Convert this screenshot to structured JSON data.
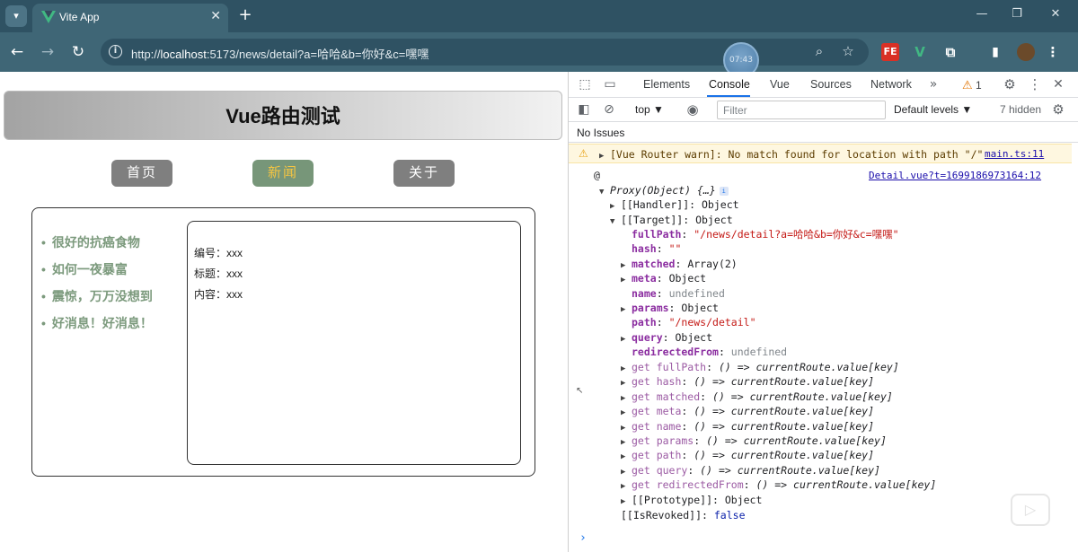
{
  "browser": {
    "tab_title": "Vite App",
    "tab_close": "✕",
    "new_tab": "+",
    "url_prefix": "http://",
    "url_host": "localhost",
    "url_rest": ":5173/news/detail?a=哈哈&b=你好&c=嘿嘿",
    "timer_badge": "07:43",
    "extensions": [
      "FE",
      "V"
    ]
  },
  "app": {
    "title": "Vue路由测试",
    "nav": [
      {
        "label": "首页",
        "active": false
      },
      {
        "label": "新闻",
        "active": true
      },
      {
        "label": "关于",
        "active": false
      }
    ],
    "news_items": [
      "很好的抗癌食物",
      "如何一夜暴富",
      "震惊，万万没想到",
      "好消息！好消息！"
    ],
    "detail": [
      {
        "label": "编号：",
        "value": "xxx"
      },
      {
        "label": "标题：",
        "value": "xxx"
      },
      {
        "label": "内容：",
        "value": "xxx"
      }
    ]
  },
  "devtools": {
    "tabs": [
      "Elements",
      "Console",
      "Vue",
      "Sources",
      "Network"
    ],
    "active_tab": "Console",
    "warning_count": "1",
    "context": "top",
    "filter_placeholder": "Filter",
    "levels": "Default levels",
    "hidden": "7 hidden",
    "issues": "No Issues",
    "warning_message": "[Vue Router warn]: No match found for location with path \"/\"",
    "warning_source": "main.ts:11",
    "log_at": "@",
    "log_source": "Detail.vue?t=1699186973164:12",
    "proxy_label": "Proxy(Object) {…}",
    "handler": "[[Handler]]: Object",
    "target": "[[Target]]: Object",
    "props": [
      {
        "key": "fullPath",
        "sep": ": ",
        "value": "\"/news/detail?a=哈哈&b=你好&c=嘿嘿\"",
        "kind": "str",
        "expandable": false
      },
      {
        "key": "hash",
        "sep": ": ",
        "value": "\"\"",
        "kind": "str",
        "expandable": false
      },
      {
        "key": "matched",
        "sep": ": ",
        "value": "Array(2)",
        "kind": "plain",
        "expandable": true
      },
      {
        "key": "meta",
        "sep": ": ",
        "value": "Object",
        "kind": "plain",
        "expandable": true
      },
      {
        "key": "name",
        "sep": ": ",
        "value": "undefined",
        "kind": "undef",
        "expandable": false
      },
      {
        "key": "params",
        "sep": ": ",
        "value": "Object",
        "kind": "plain",
        "expandable": true
      },
      {
        "key": "path",
        "sep": ": ",
        "value": "\"/news/detail\"",
        "kind": "str",
        "expandable": false
      },
      {
        "key": "query",
        "sep": ": ",
        "value": "Object",
        "kind": "plain",
        "expandable": true
      },
      {
        "key": "redirectedFrom",
        "sep": ": ",
        "value": "undefined",
        "kind": "undef",
        "expandable": false
      }
    ],
    "getters": [
      {
        "key": "get fullPath",
        "value": "() => currentRoute.value[key]"
      },
      {
        "key": "get hash",
        "value": "() => currentRoute.value[key]"
      },
      {
        "key": "get matched",
        "value": "() => currentRoute.value[key]"
      },
      {
        "key": "get meta",
        "value": "() => currentRoute.value[key]"
      },
      {
        "key": "get name",
        "value": "() => currentRoute.value[key]"
      },
      {
        "key": "get params",
        "value": "() => currentRoute.value[key]"
      },
      {
        "key": "get path",
        "value": "() => currentRoute.value[key]"
      },
      {
        "key": "get query",
        "value": "() => currentRoute.value[key]"
      },
      {
        "key": "get redirectedFrom",
        "value": "() => currentRoute.value[key]"
      }
    ],
    "prototype": "[[Prototype]]: Object",
    "revoked_key": "[[IsRevoked]]",
    "revoked_value": "false"
  }
}
